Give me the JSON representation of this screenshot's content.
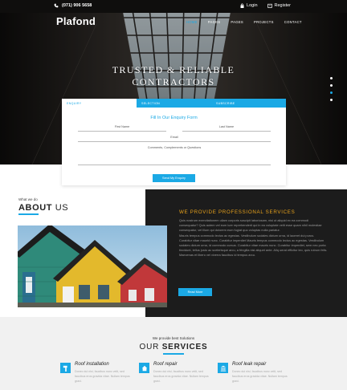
{
  "topbar": {
    "phone": "(071) 906 5658",
    "login_label": "Login",
    "register_label": "Register"
  },
  "brand": {
    "logo": "Plafond"
  },
  "nav": {
    "items": [
      "HOME",
      "PAGES",
      "PAGES",
      "PROJECTS",
      "CONTACT"
    ],
    "active_index": 0
  },
  "hero": {
    "headline_line1": "TRUSTED & RELIABLE",
    "headline_line2": "CONTRACTORS"
  },
  "slider": {
    "count": 4,
    "active_index": 2
  },
  "form": {
    "tabs": [
      "ENQUIRY",
      "SELECTION",
      "SUBSCRIBE"
    ],
    "title": "Fill In Our Enquiry Form",
    "first_name": "First Name",
    "last_name": "Last Name",
    "email": "Email",
    "comments": "Comments, Complements or Questions",
    "submit_label": "Send My Enquiry"
  },
  "about": {
    "what_we_do": "What we do",
    "title_bold": "ABOUT",
    "title_rest": " US",
    "right_title": "WE PROVIDE PROFESSIONAL SERVICES",
    "paragraph1": "Quis nostrum exercitationem ullam corporis suscipit laboriosam, nisi ut aliquid ex ea commodi consequatur? Quis autem vel eum iure reprehenderit qui in ea voluptate velit esse quam nihil molestiae consequatur, vel illum qui dolorem eum fugiat quo voluptas nulla pariatur.",
    "paragraph2": "Mauris tempus commodo lectus ac egestas. Vestibulum sodales dictum urna, id laoreet dui purus. Curabitur vitae maurid nunc. Curabitur imperdiet Mauris tempus commodo lectus ac egestas. Vestibulum sodales dictum urna, id commodo cursus. Curabitur vitae mauris nunc. Curabitur imperdiet, sem nec porta tincidunt, tellus justo ac scelerisque arcu, a fringilla nisi aliquet ante. Aliq uerat efficitur leo, quis rutrum felis. Maecenas et libero vel viverra faucibus id tempus arcu.",
    "read_more_label": "Read More"
  },
  "services": {
    "small_title": "We provide best Solutions",
    "title_rest": "OUR ",
    "title_bold": "SERVICES",
    "items": [
      {
        "name": "Roof installation",
        "desc": "Donec dui nisi, faucibus nunc velit, sed faucibus eros gravida vitae. Nullam tempus gravi.",
        "icon": "hammer-icon"
      },
      {
        "name": "Roof repair",
        "desc": "Donec dui nisi, faucibus nunc velit, sed faucibus eros gravida vitae. Nullam tempus gravi.",
        "icon": "home-icon"
      },
      {
        "name": "Roof leak repair",
        "desc": "Donec dui nisi, faucibus nunc velit, sed faucibus eros gravida vitae. Nullam tempus gravi.",
        "icon": "building-icon"
      }
    ]
  },
  "colors": {
    "accent": "#1ba9e5",
    "gold": "#e8a21b",
    "dark": "#1c1c1c"
  }
}
